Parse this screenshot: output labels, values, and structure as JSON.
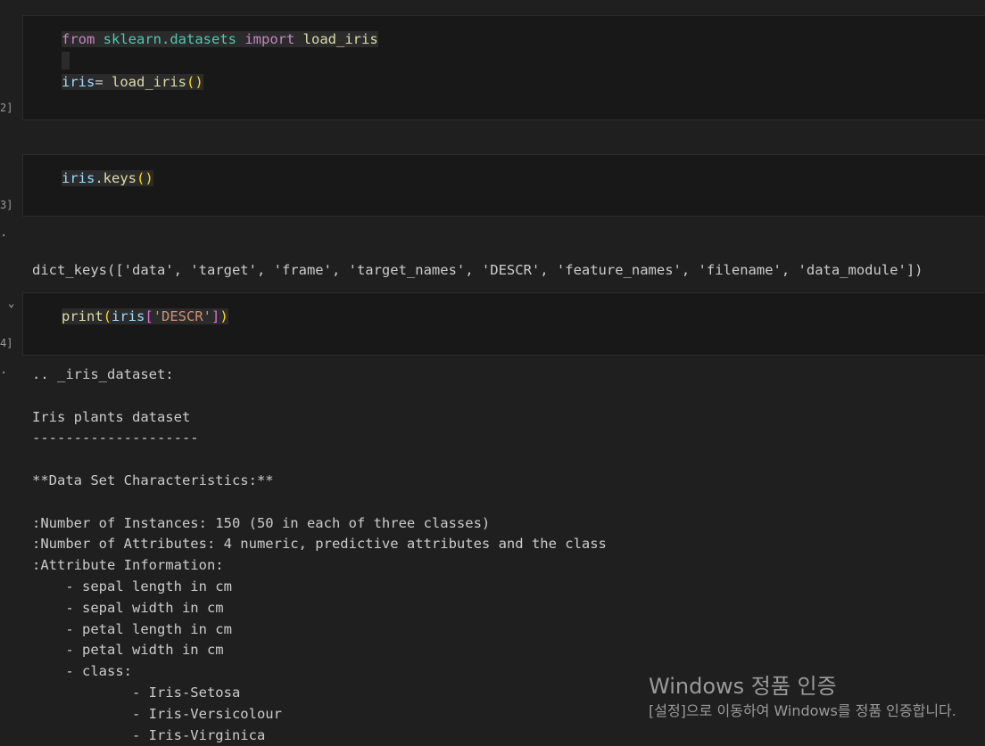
{
  "cells": [
    {
      "exec_label": "2]",
      "lines": [
        [
          [
            "kw",
            "from"
          ],
          [
            "",
            " "
          ],
          [
            "mod",
            "sklearn.datasets"
          ],
          [
            "",
            " "
          ],
          [
            "kw",
            "import"
          ],
          [
            "",
            " "
          ],
          [
            "fn",
            "load_iris"
          ]
        ],
        [],
        [
          [
            "var",
            "iris"
          ],
          [
            "",
            "= "
          ],
          [
            "fn",
            "load_iris"
          ],
          [
            "par",
            "()"
          ]
        ]
      ]
    },
    {
      "exec_label": "3]",
      "lines": [
        [
          [
            "var",
            "iris"
          ],
          [
            "",
            "."
          ],
          [
            "fn",
            "keys"
          ],
          [
            "par",
            "()"
          ]
        ]
      ]
    },
    {
      "exec_label": "4]",
      "lines": [
        [
          [
            "fn",
            "print"
          ],
          [
            "par",
            "("
          ],
          [
            "var",
            "iris"
          ],
          [
            "brk",
            "["
          ],
          [
            "str",
            "'DESCR'"
          ],
          [
            "brk",
            "]"
          ],
          [
            "par",
            ")"
          ]
        ]
      ]
    }
  ],
  "keys_output": "dict_keys(['data', 'target', 'frame', 'target_names', 'DESCR', 'feature_names', 'filename', 'data_module'])",
  "descr_output": [
    ".. _iris_dataset:",
    "",
    "Iris plants dataset",
    "--------------------",
    "",
    "**Data Set Characteristics:**",
    "",
    ":Number of Instances: 150 (50 in each of three classes)",
    ":Number of Attributes: 4 numeric, predictive attributes and the class",
    ":Attribute Information:",
    "    - sepal length in cm",
    "    - sepal width in cm",
    "    - petal length in cm",
    "    - petal width in cm",
    "    - class:",
    "            - Iris-Setosa",
    "            - Iris-Versicolour",
    "            - Iris-Virginica"
  ],
  "output_marker": "·",
  "collapse_chevron": "⌄",
  "watermark": {
    "title": "Windows 정품 인증",
    "subtitle": "[설정]으로 이동하여 Windows를 정품 인증합니다."
  },
  "colors": {
    "background": "#1f1f1f",
    "cell_background": "#181818",
    "keyword": "#c586c0",
    "module": "#4ec9b0",
    "function": "#dcdcaa",
    "variable": "#9cdcfe",
    "paren": "#ffd700",
    "bracket": "#da70d6",
    "string": "#ce9178"
  }
}
